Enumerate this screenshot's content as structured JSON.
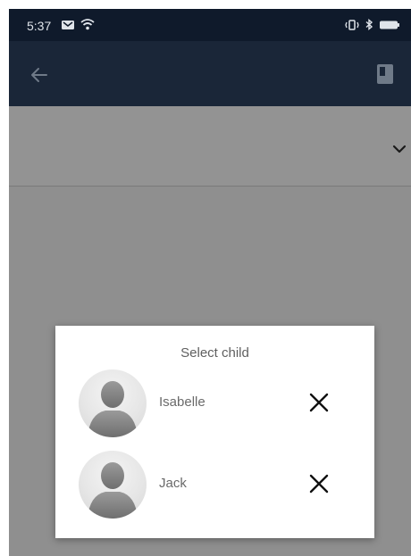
{
  "status_bar": {
    "time": "5:37",
    "left_icons": [
      "mail-icon",
      "wifi-icon"
    ],
    "right_icons": [
      "vibrate-icon",
      "bluetooth-icon",
      "battery-icon"
    ]
  },
  "app_bar": {
    "back_icon": "arrow-left-icon",
    "action_icon": "book-icon"
  },
  "dropdown": {
    "value": "",
    "icon": "chevron-down-icon"
  },
  "dialog": {
    "title": "Select child",
    "children": [
      {
        "name": "Isabelle",
        "remove_icon": "close-icon"
      },
      {
        "name": "Jack",
        "remove_icon": "close-icon"
      }
    ]
  },
  "colors": {
    "status_bar": "#0f1a2b",
    "app_bar": "#1a2638",
    "scrim": "#8f8f8f",
    "dialog_bg": "#ffffff"
  }
}
